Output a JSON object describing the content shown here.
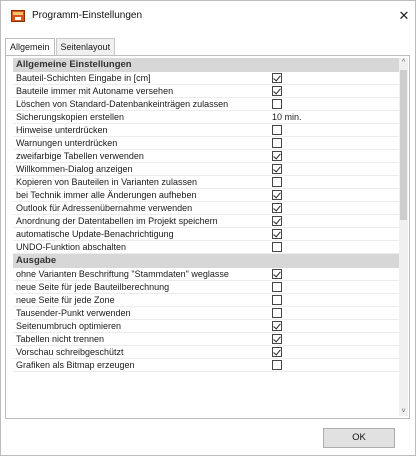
{
  "window": {
    "title": "Programm-Einstellungen",
    "close": "✕"
  },
  "tabs": [
    {
      "label": "Allgemein",
      "active": true
    },
    {
      "label": "Seitenlayout",
      "active": false
    }
  ],
  "sections": [
    {
      "title": "Allgemeine Einstellungen",
      "rows": [
        {
          "label": "Bauteil-Schichten Eingabe in [cm]",
          "type": "checkbox",
          "checked": true
        },
        {
          "label": "Bauteile immer mit Autoname versehen",
          "type": "checkbox",
          "checked": true
        },
        {
          "label": "Löschen von Standard-Datenbankeinträgen zulassen",
          "type": "checkbox",
          "checked": false
        },
        {
          "label": "Sicherungskopien erstellen",
          "type": "text",
          "value": "10 min."
        },
        {
          "label": "Hinweise unterdrücken",
          "type": "checkbox",
          "checked": false
        },
        {
          "label": "Warnungen unterdrücken",
          "type": "checkbox",
          "checked": false
        },
        {
          "label": "zweifarbige Tabellen verwenden",
          "type": "checkbox",
          "checked": true
        },
        {
          "label": "Willkommen-Dialog anzeigen",
          "type": "checkbox",
          "checked": true
        },
        {
          "label": "Kopieren von Bauteilen in Varianten zulassen",
          "type": "checkbox",
          "checked": false
        },
        {
          "label": "bei Technik immer alle Änderungen aufheben",
          "type": "checkbox",
          "checked": true
        },
        {
          "label": "Outlook für Adressenübernahme verwenden",
          "type": "checkbox",
          "checked": true
        },
        {
          "label": "Anordnung der Datentabellen im Projekt speichern",
          "type": "checkbox",
          "checked": true
        },
        {
          "label": "automatische Update-Benachrichtigung",
          "type": "checkbox",
          "checked": true
        },
        {
          "label": "UNDO-Funktion abschalten",
          "type": "checkbox",
          "checked": false
        }
      ]
    },
    {
      "title": "Ausgabe",
      "rows": [
        {
          "label": "ohne Varianten Beschriftung \"Stammdaten\" weglasse",
          "type": "checkbox",
          "checked": true
        },
        {
          "label": "neue Seite für jede Bauteilberechnung",
          "type": "checkbox",
          "checked": false
        },
        {
          "label": "neue Seite für jede Zone",
          "type": "checkbox",
          "checked": false
        },
        {
          "label": "Tausender-Punkt verwenden",
          "type": "checkbox",
          "checked": false
        },
        {
          "label": "Seitenumbruch optimieren",
          "type": "checkbox",
          "checked": true
        },
        {
          "label": "Tabellen nicht trennen",
          "type": "checkbox",
          "checked": true
        },
        {
          "label": "Vorschau schreibgeschützt",
          "type": "checkbox",
          "checked": true
        },
        {
          "label": "Grafiken als Bitmap erzeugen",
          "type": "checkbox",
          "checked": false
        }
      ]
    }
  ],
  "scrollbar": {
    "up": "^",
    "down": "˅"
  },
  "footer": {
    "ok_label": "OK"
  },
  "icons": {
    "app": "app-icon",
    "close": "close-icon"
  }
}
